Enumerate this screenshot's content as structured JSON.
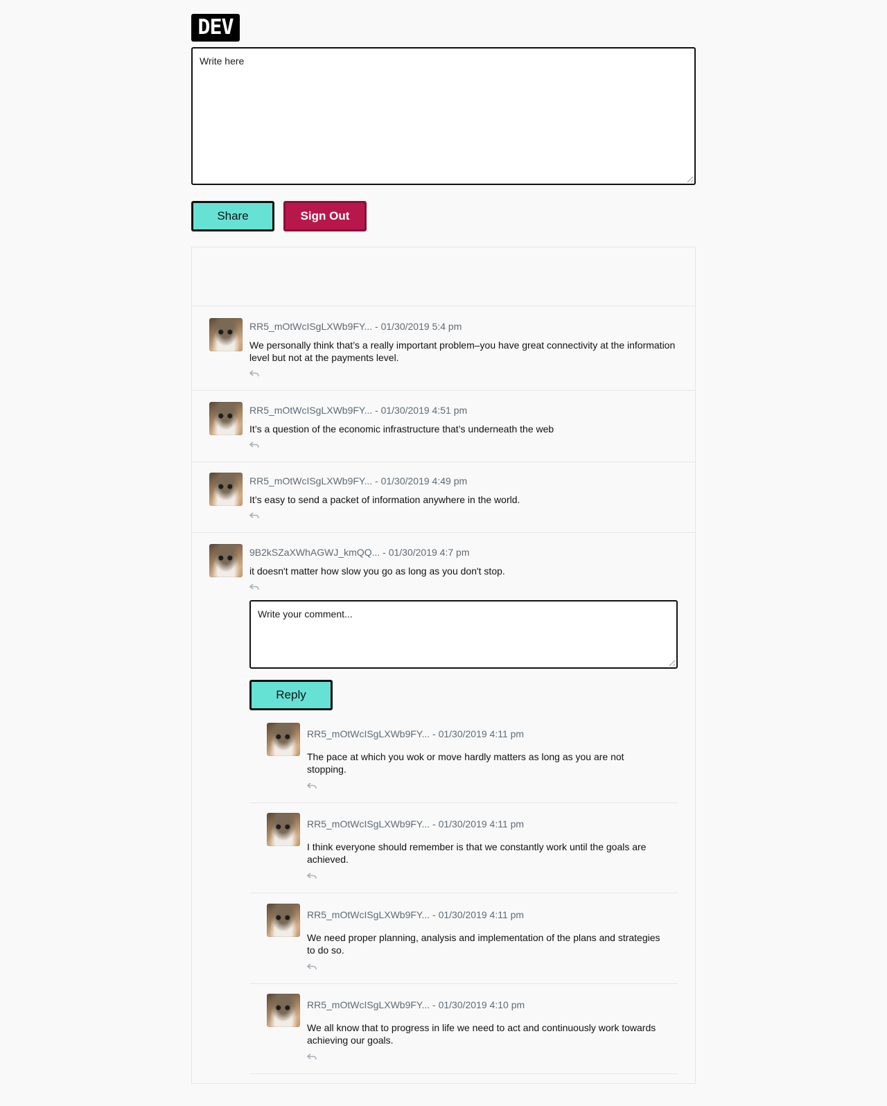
{
  "logo_text": "DEV",
  "composer": {
    "placeholder": "Write here"
  },
  "buttons": {
    "share": "Share",
    "sign_out": "Sign Out",
    "reply": "Reply"
  },
  "reply_composer": {
    "placeholder": "Write your comment..."
  },
  "comments": [
    {
      "author": "RR5_mOtWcISgLXWb9FY...",
      "date": "01/30/2019 5:4 pm",
      "text": "We personally think that’s a really important problem–you have great connectivity at the information level but not at the payments level."
    },
    {
      "author": "RR5_mOtWcISgLXWb9FY...",
      "date": "01/30/2019 4:51 pm",
      "text": "It’s a question of the economic infrastructure that’s underneath the web"
    },
    {
      "author": "RR5_mOtWcISgLXWb9FY...",
      "date": "01/30/2019 4:49 pm",
      "text": "It’s easy to send a packet of information anywhere in the world."
    },
    {
      "author": "9B2kSZaXWhAGWJ_kmQQ...",
      "date": "01/30/2019 4:7 pm",
      "text": "it doesn't matter how slow you go as long as you don't stop."
    }
  ],
  "replies": [
    {
      "author": "RR5_mOtWcISgLXWb9FY...",
      "date": "01/30/2019 4:11 pm",
      "text": "The pace at which you wok or move hardly matters as long as you are not stopping."
    },
    {
      "author": "RR5_mOtWcISgLXWb9FY...",
      "date": "01/30/2019 4:11 pm",
      "text": "I think everyone should remember is that we constantly work until the goals are achieved."
    },
    {
      "author": "RR5_mOtWcISgLXWb9FY...",
      "date": "01/30/2019 4:11 pm",
      "text": "We need proper planning, analysis and implementation of the plans and strategies to do so."
    },
    {
      "author": "RR5_mOtWcISgLXWb9FY...",
      "date": "01/30/2019 4:10 pm",
      "text": "We all know that to progress in life we need to act and continuously work towards achieving our goals."
    }
  ],
  "date_separator": " - "
}
